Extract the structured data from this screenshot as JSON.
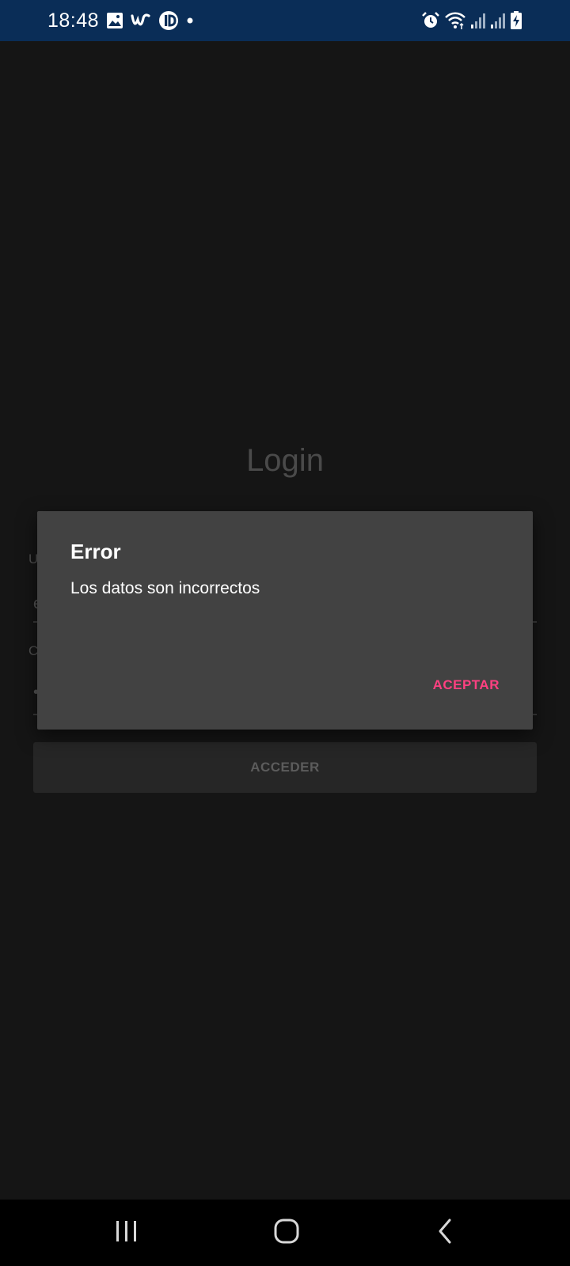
{
  "status_bar": {
    "time": "18:48",
    "left_icons": [
      "gallery-icon",
      "w-app-icon",
      "info-app-icon",
      "notification-dot-icon"
    ],
    "right_icons": [
      "alarm-icon",
      "wifi-icon",
      "signal-icon",
      "signal-icon",
      "battery-charging-icon"
    ],
    "background": "#0a2d57"
  },
  "login": {
    "title": "Login",
    "user_label": "U",
    "user_value": "e",
    "password_label": "C",
    "password_value": "•",
    "access_button": "ACCEDER"
  },
  "dialog": {
    "title": "Error",
    "message": "Los datos son incorrectos",
    "ok_label": "ACEPTAR",
    "accent_color": "#ff4081"
  },
  "nav_bar": {
    "buttons": [
      "recents-icon",
      "home-icon",
      "back-icon"
    ]
  }
}
